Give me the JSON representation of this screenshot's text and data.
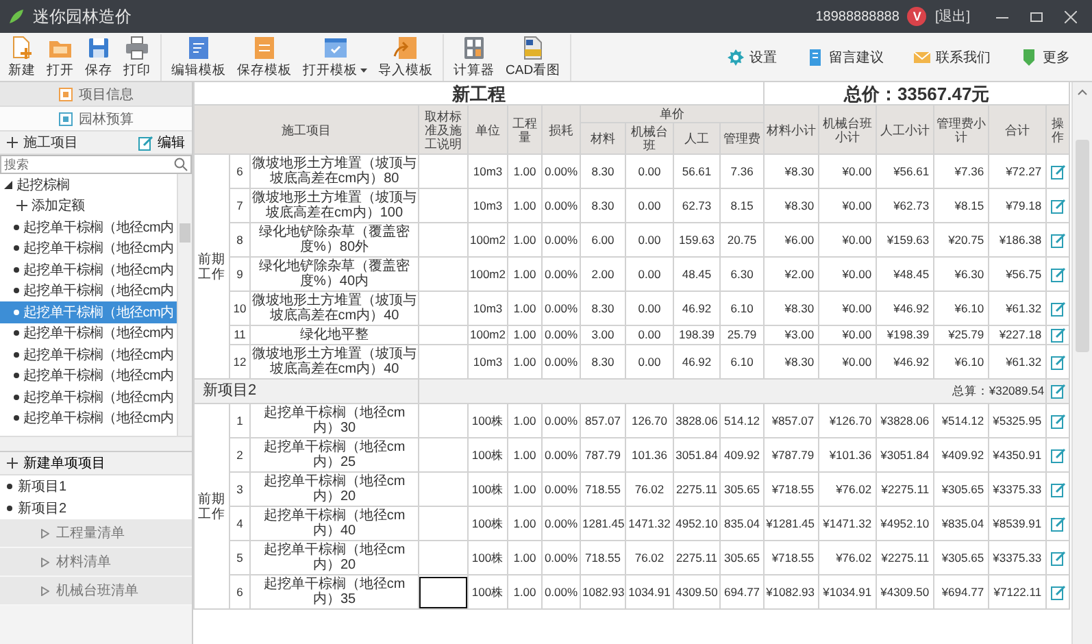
{
  "window": {
    "title": "迷你园林造价",
    "phone": "18988888888",
    "avatar_letter": "V",
    "logout": "[退出]"
  },
  "toolbar": {
    "groups": [
      [
        {
          "label": "新建",
          "dropdown": false
        },
        {
          "label": "打开",
          "dropdown": false
        },
        {
          "label": "保存",
          "dropdown": false
        },
        {
          "label": "打印",
          "dropdown": false
        }
      ],
      [
        {
          "label": "编辑模板",
          "dropdown": false
        },
        {
          "label": "保存模板",
          "dropdown": false
        },
        {
          "label": "打开模板",
          "dropdown": true
        },
        {
          "label": "导入模板",
          "dropdown": false
        }
      ],
      [
        {
          "label": "计算器",
          "dropdown": false
        },
        {
          "label": "CAD看图",
          "dropdown": false
        }
      ]
    ],
    "right": [
      "设置",
      "留言建议",
      "联系我们",
      "更多"
    ]
  },
  "side_tabs": [
    {
      "label": "项目信息",
      "selected": false
    },
    {
      "label": "园林预算",
      "selected": true
    }
  ],
  "construction_panel": {
    "title": "施工项目",
    "edit": "编辑",
    "search_placeholder": "搜索",
    "tree": [
      {
        "label": "起挖棕榈",
        "expanded": true,
        "children": [
          {
            "label": "添加定额",
            "kind": "add",
            "selected": false
          },
          {
            "label": "起挖单干棕榈（地径cm内",
            "kind": "item",
            "selected": false
          },
          {
            "label": "起挖单干棕榈（地径cm内",
            "kind": "item",
            "selected": false
          },
          {
            "label": "起挖单干棕榈（地径cm内",
            "kind": "item",
            "selected": false
          },
          {
            "label": "起挖单干棕榈（地径cm内",
            "kind": "item",
            "selected": false
          },
          {
            "label": "起挖单干棕榈（地径cm内",
            "kind": "item",
            "selected": true
          },
          {
            "label": "起挖单干棕榈（地径cm内",
            "kind": "item",
            "selected": false
          },
          {
            "label": "起挖单干棕榈（地径cm内",
            "kind": "item",
            "selected": false
          },
          {
            "label": "起挖单干棕榈（地径cm内",
            "kind": "item",
            "selected": false
          },
          {
            "label": "起挖单干棕榈（地径cm内",
            "kind": "item",
            "selected": false
          },
          {
            "label": "起挖单干棕榈（地径cm内",
            "kind": "item",
            "selected": false
          }
        ]
      }
    ]
  },
  "projects": {
    "new_label": "新建单项项目",
    "items": [
      "新项目1",
      "新项目2"
    ]
  },
  "lists": [
    "工程量清单",
    "材料清单",
    "机械台班清单"
  ],
  "sheet": {
    "title": "新工程",
    "total": "总价：33567.47元",
    "header": {
      "item": "施工项目",
      "spec": "取材标准及施工说明",
      "unit": "单位",
      "qty": "工程量",
      "loss": "损耗",
      "unit_price": "单价",
      "unit_price_parts": [
        "材料",
        "机械台班",
        "人工",
        "管理费"
      ],
      "subtotals": [
        "材料小计",
        "机械台班小计",
        "人工小计",
        "管理费小计",
        "合计"
      ],
      "action": "操作"
    },
    "groups": [
      {
        "stage": "前期工作",
        "rows": [
          {
            "no": "6",
            "name": "微坡地形土方堆置（坡顶与坡底高差在cm内）80",
            "unit": "10m3",
            "qty": "1.00",
            "loss": "0.00%",
            "prices": [
              "8.30",
              "0.00",
              "56.61",
              "7.36"
            ],
            "subtotals": [
              "¥8.30",
              "¥0.00",
              "¥56.61",
              "¥7.36",
              "¥72.27"
            ],
            "editing": false
          },
          {
            "no": "7",
            "name": "微坡地形土方堆置（坡顶与坡底高差在cm内）100",
            "unit": "10m3",
            "qty": "1.00",
            "loss": "0.00%",
            "prices": [
              "8.30",
              "0.00",
              "62.73",
              "8.15"
            ],
            "subtotals": [
              "¥8.30",
              "¥0.00",
              "¥62.73",
              "¥8.15",
              "¥79.18"
            ],
            "editing": false
          },
          {
            "no": "8",
            "name": "绿化地铲除杂草（覆盖密度%）80外",
            "unit": "100m2",
            "qty": "1.00",
            "loss": "0.00%",
            "prices": [
              "6.00",
              "0.00",
              "159.63",
              "20.75"
            ],
            "subtotals": [
              "¥6.00",
              "¥0.00",
              "¥159.63",
              "¥20.75",
              "¥186.38"
            ],
            "editing": false
          },
          {
            "no": "9",
            "name": "绿化地铲除杂草（覆盖密度%）40内",
            "unit": "100m2",
            "qty": "1.00",
            "loss": "0.00%",
            "prices": [
              "2.00",
              "0.00",
              "48.45",
              "6.30"
            ],
            "subtotals": [
              "¥2.00",
              "¥0.00",
              "¥48.45",
              "¥6.30",
              "¥56.75"
            ],
            "editing": false
          },
          {
            "no": "10",
            "name": "微坡地形土方堆置（坡顶与坡底高差在cm内）40",
            "unit": "10m3",
            "qty": "1.00",
            "loss": "0.00%",
            "prices": [
              "8.30",
              "0.00",
              "46.92",
              "6.10"
            ],
            "subtotals": [
              "¥8.30",
              "¥0.00",
              "¥46.92",
              "¥6.10",
              "¥61.32"
            ],
            "editing": false
          },
          {
            "no": "11",
            "name": "绿化地平整",
            "unit": "100m2",
            "qty": "1.00",
            "loss": "0.00%",
            "prices": [
              "3.00",
              "0.00",
              "198.39",
              "25.79"
            ],
            "subtotals": [
              "¥3.00",
              "¥0.00",
              "¥198.39",
              "¥25.79",
              "¥227.18"
            ],
            "editing": false
          },
          {
            "no": "12",
            "name": "微坡地形土方堆置（坡顶与坡底高差在cm内）40",
            "unit": "10m3",
            "qty": "1.00",
            "loss": "0.00%",
            "prices": [
              "8.30",
              "0.00",
              "46.92",
              "6.10"
            ],
            "subtotals": [
              "¥8.30",
              "¥0.00",
              "¥46.92",
              "¥6.10",
              "¥61.32"
            ],
            "editing": false
          }
        ]
      },
      {
        "title": "新项目2",
        "sum": "总算：¥32089.54",
        "stage": "前期工作",
        "rows": [
          {
            "no": "1",
            "name": "起挖单干棕榈（地径cm内）30",
            "unit": "100株",
            "qty": "1.00",
            "loss": "0.00%",
            "prices": [
              "857.07",
              "126.70",
              "3828.06",
              "514.12"
            ],
            "subtotals": [
              "¥857.07",
              "¥126.70",
              "¥3828.06",
              "¥514.12",
              "¥5325.95"
            ],
            "editing": false
          },
          {
            "no": "2",
            "name": "起挖单干棕榈（地径cm内）25",
            "unit": "100株",
            "qty": "1.00",
            "loss": "0.00%",
            "prices": [
              "787.79",
              "101.36",
              "3051.84",
              "409.92"
            ],
            "subtotals": [
              "¥787.79",
              "¥101.36",
              "¥3051.84",
              "¥409.92",
              "¥4350.91"
            ],
            "editing": false
          },
          {
            "no": "3",
            "name": "起挖单干棕榈（地径cm内）20",
            "unit": "100株",
            "qty": "1.00",
            "loss": "0.00%",
            "prices": [
              "718.55",
              "76.02",
              "2275.11",
              "305.65"
            ],
            "subtotals": [
              "¥718.55",
              "¥76.02",
              "¥2275.11",
              "¥305.65",
              "¥3375.33"
            ],
            "editing": false
          },
          {
            "no": "4",
            "name": "起挖单干棕榈（地径cm内）40",
            "unit": "100株",
            "qty": "1.00",
            "loss": "0.00%",
            "prices": [
              "1281.45",
              "1471.32",
              "4952.10",
              "835.04"
            ],
            "subtotals": [
              "¥1281.45",
              "¥1471.32",
              "¥4952.10",
              "¥835.04",
              "¥8539.91"
            ],
            "editing": false
          },
          {
            "no": "5",
            "name": "起挖单干棕榈（地径cm内）20",
            "unit": "100株",
            "qty": "1.00",
            "loss": "0.00%",
            "prices": [
              "718.55",
              "76.02",
              "2275.11",
              "305.65"
            ],
            "subtotals": [
              "¥718.55",
              "¥76.02",
              "¥2275.11",
              "¥305.65",
              "¥3375.33"
            ],
            "editing": false
          },
          {
            "no": "6",
            "name": "起挖单干棕榈（地径cm内）35",
            "unit": "100株",
            "qty": "1.00",
            "loss": "0.00%",
            "prices": [
              "1082.93",
              "1034.91",
              "4309.50",
              "694.77"
            ],
            "subtotals": [
              "¥1082.93",
              "¥1034.91",
              "¥4309.50",
              "¥694.77",
              "¥7122.11"
            ],
            "editing": true
          }
        ]
      }
    ]
  }
}
